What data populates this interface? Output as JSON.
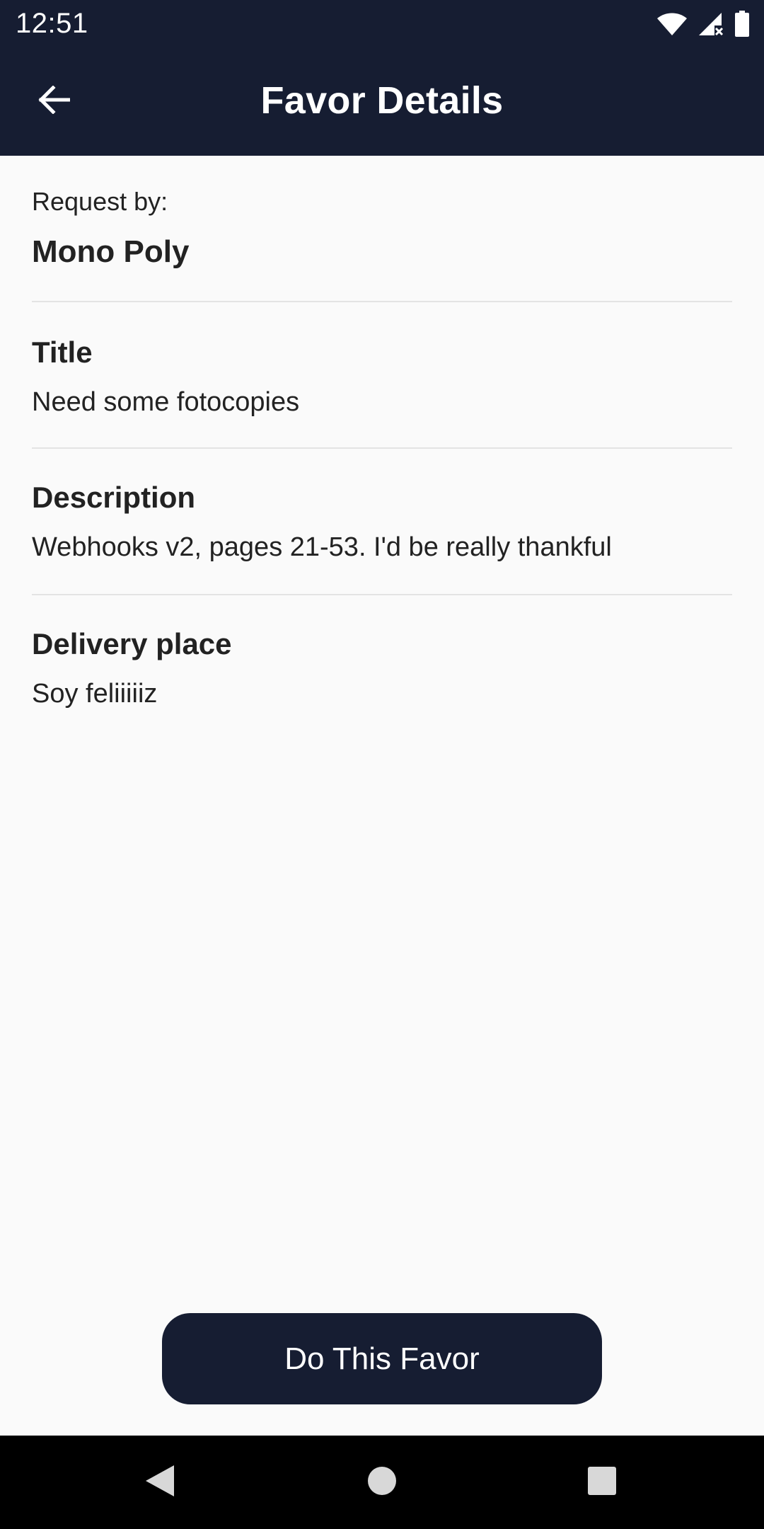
{
  "status_bar": {
    "time": "12:51",
    "icons": [
      "wifi-icon",
      "cell-signal-icon",
      "battery-icon"
    ]
  },
  "app_bar": {
    "title": "Favor Details",
    "back_icon": "arrow-back-icon"
  },
  "request": {
    "label": "Request by:",
    "name": "Mono Poly"
  },
  "fields": [
    {
      "label": "Title",
      "value": "Need some fotocopies"
    },
    {
      "label": "Description",
      "value": "Webhooks v2, pages 21-53. I'd be really thankful"
    },
    {
      "label": "Delivery place",
      "value": "Soy feliiiiiz"
    }
  ],
  "action": {
    "label": "Do This Favor"
  },
  "nav_bar": {
    "icons": [
      "nav-back-icon",
      "nav-home-icon",
      "nav-recents-icon"
    ]
  },
  "colors": {
    "primary": "#161d32",
    "background": "#fafafa",
    "divider": "#e3e3e3",
    "text": "#222222"
  }
}
